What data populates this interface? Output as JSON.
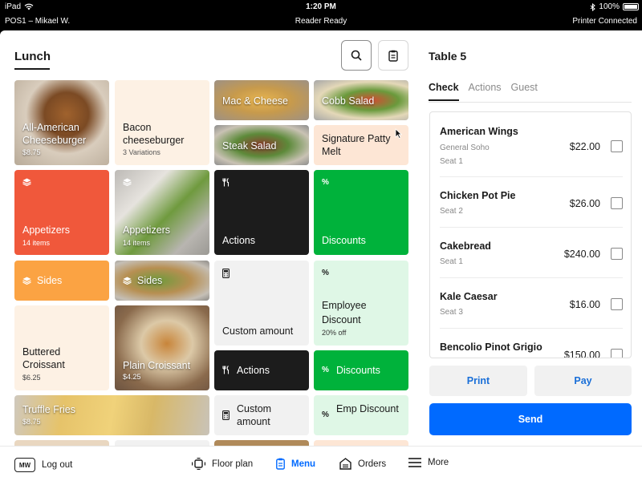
{
  "status_bar": {
    "device": "iPad",
    "time": "1:20 PM",
    "battery": "100%",
    "device_user": "POS1 – Mikael W.",
    "reader_status": "Reader Ready",
    "printer_status": "Printer Connected"
  },
  "menu": {
    "title": "Lunch",
    "tiles": [
      {
        "label": "All-American Cheeseburger",
        "sub": "$8.75"
      },
      {
        "label": "Bacon cheeseburger",
        "sub": "3 Variations"
      },
      {
        "label": "Mac & Cheese",
        "sub": ""
      },
      {
        "label": "Cobb Salad",
        "sub": ""
      },
      {
        "label": "Steak Salad",
        "sub": ""
      },
      {
        "label": "Signature Patty Melt",
        "sub": ""
      },
      {
        "label": "Appetizers",
        "sub": "14 items"
      },
      {
        "label": "Appetizers",
        "sub": "14 items"
      },
      {
        "label": "Actions",
        "sub": ""
      },
      {
        "label": "Discounts",
        "sub": ""
      },
      {
        "label": "Sides",
        "sub": ""
      },
      {
        "label": "Sides",
        "sub": ""
      },
      {
        "label": "Custom amount",
        "sub": ""
      },
      {
        "label": "Employee Discount",
        "sub": "20% off"
      },
      {
        "label": "Buttered Croissant",
        "sub": "$6.25"
      },
      {
        "label": "Plain Croissant",
        "sub": "$4.25"
      },
      {
        "label": "Actions",
        "sub": ""
      },
      {
        "label": "Discounts",
        "sub": ""
      },
      {
        "label": "Truffle Fries",
        "sub": "$8.75"
      },
      {
        "label": "Custom amount",
        "sub": ""
      },
      {
        "label": "Emp Discount",
        "sub": ""
      }
    ]
  },
  "check": {
    "title": "Table 5",
    "tabs": [
      "Check",
      "Actions",
      "Guest"
    ],
    "items": [
      {
        "name": "American Wings",
        "sub1": "General Soho",
        "sub2": "Seat 1",
        "price": "$22.00"
      },
      {
        "name": "Chicken Pot Pie",
        "sub1": "Seat 2",
        "sub2": "",
        "price": "$26.00"
      },
      {
        "name": "Cakebread",
        "sub1": "Seat 1",
        "sub2": "",
        "price": "$240.00"
      },
      {
        "name": "Kale Caesar",
        "sub1": "Seat 3",
        "sub2": "",
        "price": "$16.00"
      },
      {
        "name": "Bencolio Pinot Grigio",
        "sub1": "",
        "sub2": "",
        "price": "$150.00"
      }
    ],
    "print_label": "Print",
    "pay_label": "Pay",
    "send_label": "Send"
  },
  "bottom_nav": {
    "avatar_initials": "MW",
    "logout": "Log out",
    "floor_plan": "Floor plan",
    "menu": "Menu",
    "orders": "Orders",
    "more": "More"
  },
  "colors": {
    "accent": "#006aff",
    "appetizers": "#f0583b",
    "actions": "#1c1c1c",
    "discounts": "#00b23b",
    "sides": "#fba343",
    "cream": "#fdf1e4",
    "light_green": "#dff7e6",
    "light_grey": "#f1f1f1",
    "peach": "#fde6d5"
  },
  "icons": [
    "wifi-icon",
    "bluetooth-icon",
    "battery-icon",
    "search-icon",
    "clipboard-icon",
    "stack-icon",
    "fork-knife-icon",
    "percent-icon",
    "calculator-icon",
    "cursor-icon",
    "floor-plan-icon",
    "menu-icon",
    "orders-icon",
    "hamburger-icon"
  ]
}
